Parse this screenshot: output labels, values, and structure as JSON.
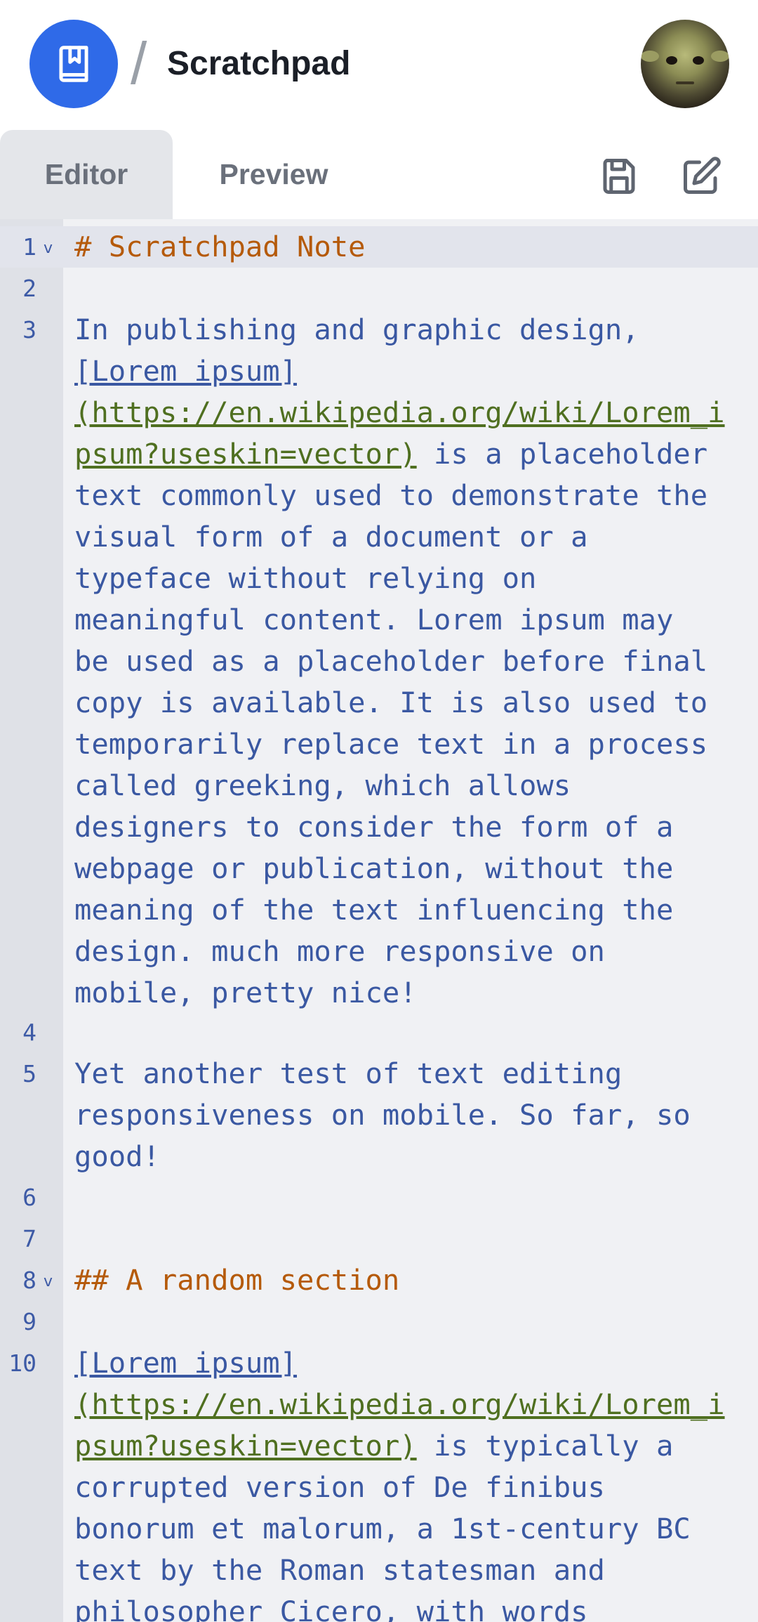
{
  "header": {
    "title": "Scratchpad",
    "separator": "/",
    "logo_icon": "book-bookmark-icon",
    "avatar_icon": "user-avatar",
    "accent": "#2f6ae8"
  },
  "toolbar": {
    "tabs": [
      {
        "label": "Editor",
        "active": true
      },
      {
        "label": "Preview",
        "active": false
      }
    ],
    "save_icon": "save-icon",
    "edit_icon": "edit-icon"
  },
  "editor": {
    "colors": {
      "heading": "#b55a0a",
      "text": "#3a58a2",
      "url": "#4f6f20",
      "line_number": "#3d5aa6"
    },
    "line_numbers": [
      "1",
      "2",
      "3",
      "4",
      "5",
      "6",
      "7",
      "8",
      "9",
      "10"
    ],
    "fold_marker": "v",
    "lines": {
      "l1": "# Scratchpad Note",
      "l3a": "In publishing and graphic design,",
      "l3b": "[Lorem ipsum]",
      "l3c": "(https://en.wikipedia.org/wiki/Lorem_i",
      "l3d_url": "psum?useskin=vector)",
      "l3d_rest": " is a placeholder",
      "l3e": "text commonly used to demonstrate the",
      "l3f": "visual form of a document or a",
      "l3g": "typeface without relying on",
      "l3h": "meaningful content. Lorem ipsum may",
      "l3i": "be used as a placeholder before final",
      "l3j": "copy is available. It is also used to",
      "l3k": "temporarily replace text in a process",
      "l3l": "called greeking, which allows",
      "l3m": "designers to consider the form of a",
      "l3n": "webpage or publication, without the",
      "l3o": "meaning of the text influencing the",
      "l3p": "design. much more responsive on",
      "l3q": "mobile, pretty nice!",
      "l5a": "Yet another test of text editing",
      "l5b": "responsiveness on mobile. So far, so",
      "l5c": "good!",
      "l8": "## A random section",
      "l10a": "[Lorem ipsum]",
      "l10b": "(https://en.wikipedia.org/wiki/Lorem_i",
      "l10c_url": "psum?useskin=vector)",
      "l10c_rest": " is typically a",
      "l10d": "corrupted version of De finibus",
      "l10e": "bonorum et malorum, a 1st-century BC",
      "l10f": "text by the Roman statesman and",
      "l10g": "philosopher Cicero, with words"
    }
  }
}
